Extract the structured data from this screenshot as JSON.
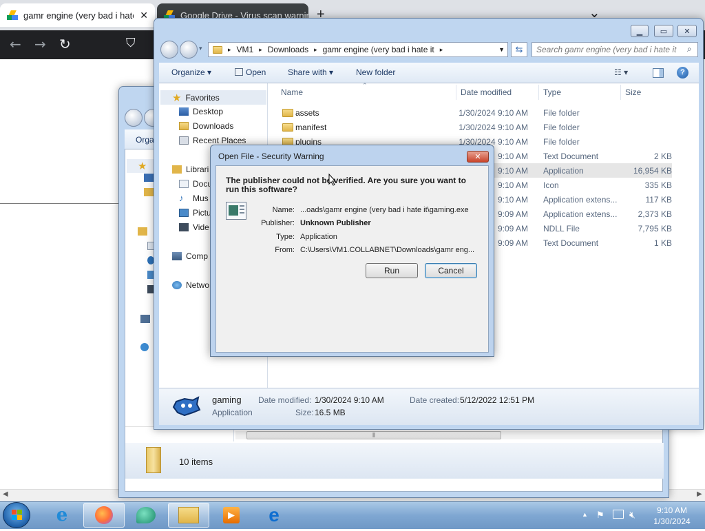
{
  "browser": {
    "tabs": [
      {
        "label": "gamr engine (very bad i hate it"
      },
      {
        "label": "Google Drive - Virus scan warning"
      }
    ],
    "new_tab": "+",
    "dropdown": "⌄"
  },
  "back_explorer": {
    "cmd_organize": "Orga",
    "nav_items": [
      "Favorites",
      "Libraries",
      "Documents",
      "Music",
      "Pictures",
      "Videos",
      "Computer",
      "Network"
    ],
    "nav_items_visible": [
      "Librari",
      "Docu",
      "Mus",
      "Pictu",
      "Vide",
      "Comp",
      "Netwo"
    ],
    "status": "10 items",
    "scroll_grip": "⦀"
  },
  "front_explorer": {
    "breadcrumb": [
      "VM1",
      "Downloads",
      "gamr engine (very bad i hate it"
    ],
    "search_placeholder": "Search gamr engine (very bad i hate it",
    "toolbar": {
      "organize": "Organize",
      "open": "Open",
      "share_with": "Share with",
      "new_folder": "New folder"
    },
    "nav": {
      "favorites": "Favorites",
      "desktop": "Desktop",
      "downloads": "Downloads",
      "recent_places": "Recent Places"
    },
    "columns": {
      "name": "Name",
      "date_modified": "Date modified",
      "type": "Type",
      "size": "Size"
    },
    "files": [
      {
        "name": "assets",
        "date": "1/30/2024 9:10 AM",
        "type": "File folder",
        "size": ""
      },
      {
        "name": "manifest",
        "date": "1/30/2024 9:10 AM",
        "type": "File folder",
        "size": ""
      },
      {
        "name": "plugins",
        "date": "1/30/2024 9:10 AM",
        "type": "File folder",
        "size": ""
      },
      {
        "name": "",
        "date": "9:10 AM",
        "type": "Text Document",
        "size": "2 KB"
      },
      {
        "name": "",
        "date": "9:10 AM",
        "type": "Application",
        "size": "16,954 KB"
      },
      {
        "name": "",
        "date": "9:10 AM",
        "type": "Icon",
        "size": "335 KB"
      },
      {
        "name": "",
        "date": "9:10 AM",
        "type": "Application extens...",
        "size": "117 KB"
      },
      {
        "name": "",
        "date": "9:09 AM",
        "type": "Application extens...",
        "size": "2,373 KB"
      },
      {
        "name": "",
        "date": "9:09 AM",
        "type": "NDLL File",
        "size": "7,795 KB"
      },
      {
        "name": "",
        "date": "9:09 AM",
        "type": "Text Document",
        "size": "1 KB"
      }
    ],
    "details": {
      "name": "gaming",
      "kind": "Application",
      "date_modified_label": "Date modified:",
      "date_modified": "1/30/2024 9:10 AM",
      "date_created_label": "Date created:",
      "date_created": "5/12/2022 12:51 PM",
      "size_label": "Size:",
      "size": "16.5 MB"
    }
  },
  "dialog": {
    "title": "Open File - Security Warning",
    "heading": "The publisher could not be verified.  Are you sure you want to run this software?",
    "fields": [
      {
        "label": "Name:",
        "value": "...oads\\gamr engine (very bad i hate it\\gaming.exe"
      },
      {
        "label": "Publisher:",
        "value": "Unknown Publisher"
      },
      {
        "label": "Type:",
        "value": "Application"
      },
      {
        "label": "From:",
        "value": "C:\\Users\\VM1.COLLABNET\\Downloads\\gamr eng..."
      }
    ],
    "run": "Run",
    "cancel": "Cancel",
    "close_glyph": "✕"
  },
  "taskbar": {
    "time": "9:10 AM",
    "date": "1/30/2024",
    "tray_up": "▲"
  },
  "colors": {
    "taskbar": "#7fa7d2",
    "window_frame": "#bfd6f0",
    "selected_row": "#e6e6e6",
    "browser_dark": "#202124"
  }
}
